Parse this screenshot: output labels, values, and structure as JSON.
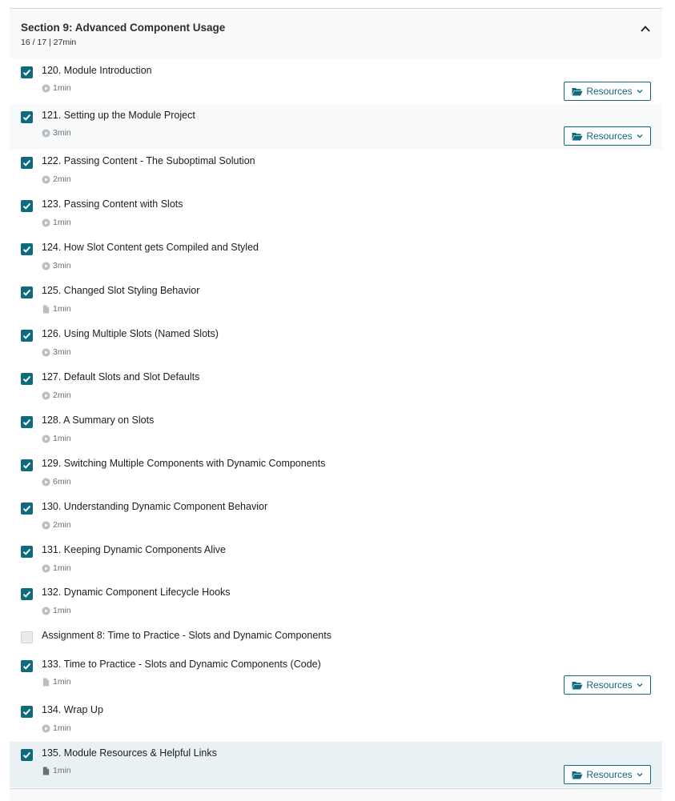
{
  "section": {
    "title": "Section 9: Advanced Component Usage",
    "meta": "16 / 17 | 27min"
  },
  "resources_label": "Resources",
  "items": [
    {
      "title": "120. Module Introduction",
      "duration": "1min",
      "kind": "video",
      "checked": true,
      "resources": true
    },
    {
      "title": "121. Setting up the Module Project",
      "duration": "3min",
      "kind": "video",
      "checked": true,
      "resources": true
    },
    {
      "title": "122. Passing Content - The Suboptimal Solution",
      "duration": "2min",
      "kind": "video",
      "checked": true,
      "resources": false
    },
    {
      "title": "123. Passing Content with Slots",
      "duration": "1min",
      "kind": "video",
      "checked": true,
      "resources": false
    },
    {
      "title": "124. How Slot Content gets Compiled and Styled",
      "duration": "3min",
      "kind": "video",
      "checked": true,
      "resources": false
    },
    {
      "title": "125. Changed Slot Styling Behavior",
      "duration": "1min",
      "kind": "article",
      "checked": true,
      "resources": false
    },
    {
      "title": "126. Using Multiple Slots (Named Slots)",
      "duration": "3min",
      "kind": "video",
      "checked": true,
      "resources": false
    },
    {
      "title": "127. Default Slots and Slot Defaults",
      "duration": "2min",
      "kind": "video",
      "checked": true,
      "resources": false
    },
    {
      "title": "128. A Summary on Slots",
      "duration": "1min",
      "kind": "video",
      "checked": true,
      "resources": false
    },
    {
      "title": "129. Switching Multiple Components with Dynamic Components",
      "duration": "6min",
      "kind": "video",
      "checked": true,
      "resources": false
    },
    {
      "title": "130. Understanding Dynamic Component Behavior",
      "duration": "2min",
      "kind": "video",
      "checked": true,
      "resources": false
    },
    {
      "title": "131. Keeping Dynamic Components Alive",
      "duration": "1min",
      "kind": "video",
      "checked": true,
      "resources": false
    },
    {
      "title": "132. Dynamic Component Lifecycle Hooks",
      "duration": "1min",
      "kind": "video",
      "checked": true,
      "resources": false
    },
    {
      "title": "Assignment 8: Time to Practice - Slots and Dynamic Components",
      "duration": "",
      "kind": "assignment",
      "checked": false,
      "resources": false
    },
    {
      "title": "133. Time to Practice - Slots and Dynamic Components (Code)",
      "duration": "1min",
      "kind": "article",
      "checked": true,
      "resources": true
    },
    {
      "title": "134. Wrap Up",
      "duration": "1min",
      "kind": "video",
      "checked": true,
      "resources": false
    },
    {
      "title": "135. Module Resources & Helpful Links",
      "duration": "1min",
      "kind": "article-current",
      "checked": true,
      "resources": true
    }
  ],
  "colors": {
    "accent": "#0f6a7d",
    "header_bg": "#f7f9fa",
    "current_bg": "#e9f1f5"
  }
}
